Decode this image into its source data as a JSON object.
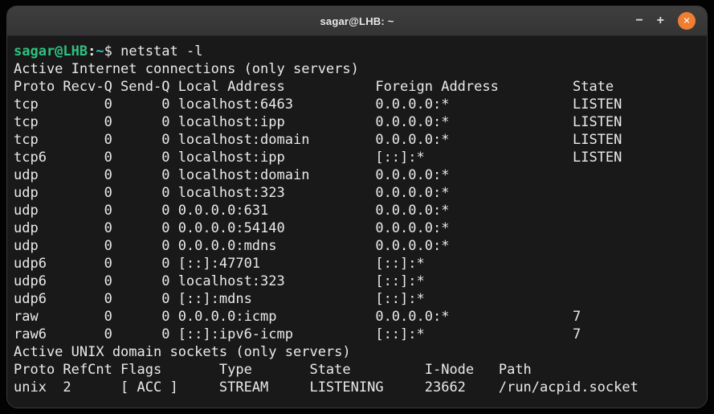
{
  "window": {
    "title": "sagar@LHB: ~",
    "controls": {
      "minimize_glyph": "−",
      "maximize_glyph": "+",
      "close_glyph": "✕"
    }
  },
  "colors": {
    "prompt_green": "#2ec27e",
    "prompt_teal": "#34c2ab",
    "close_button_orange": "#ef7d32",
    "terminal_foreground": "#eaeaea"
  },
  "terminal": {
    "prompt": {
      "user_host": "sagar@LHB",
      "separator": ":",
      "path": "~",
      "symbol": "$",
      "command": "netstat -l"
    },
    "internet_section": {
      "title": "Active Internet connections (only servers)",
      "headers": {
        "proto": "Proto",
        "recv_q": "Recv-Q",
        "send_q": "Send-Q",
        "local": "Local Address",
        "foreign": "Foreign Address",
        "state": "State"
      },
      "rows": [
        {
          "proto": "tcp",
          "recv_q": "0",
          "send_q": "0",
          "local": "localhost:6463",
          "foreign": "0.0.0.0:*",
          "state": "LISTEN"
        },
        {
          "proto": "tcp",
          "recv_q": "0",
          "send_q": "0",
          "local": "localhost:ipp",
          "foreign": "0.0.0.0:*",
          "state": "LISTEN"
        },
        {
          "proto": "tcp",
          "recv_q": "0",
          "send_q": "0",
          "local": "localhost:domain",
          "foreign": "0.0.0.0:*",
          "state": "LISTEN"
        },
        {
          "proto": "tcp6",
          "recv_q": "0",
          "send_q": "0",
          "local": "localhost:ipp",
          "foreign": "[::]:*",
          "state": "LISTEN"
        },
        {
          "proto": "udp",
          "recv_q": "0",
          "send_q": "0",
          "local": "localhost:domain",
          "foreign": "0.0.0.0:*",
          "state": ""
        },
        {
          "proto": "udp",
          "recv_q": "0",
          "send_q": "0",
          "local": "localhost:323",
          "foreign": "0.0.0.0:*",
          "state": ""
        },
        {
          "proto": "udp",
          "recv_q": "0",
          "send_q": "0",
          "local": "0.0.0.0:631",
          "foreign": "0.0.0.0:*",
          "state": ""
        },
        {
          "proto": "udp",
          "recv_q": "0",
          "send_q": "0",
          "local": "0.0.0.0:54140",
          "foreign": "0.0.0.0:*",
          "state": ""
        },
        {
          "proto": "udp",
          "recv_q": "0",
          "send_q": "0",
          "local": "0.0.0.0:mdns",
          "foreign": "0.0.0.0:*",
          "state": ""
        },
        {
          "proto": "udp6",
          "recv_q": "0",
          "send_q": "0",
          "local": "[::]:47701",
          "foreign": "[::]:*",
          "state": ""
        },
        {
          "proto": "udp6",
          "recv_q": "0",
          "send_q": "0",
          "local": "localhost:323",
          "foreign": "[::]:*",
          "state": ""
        },
        {
          "proto": "udp6",
          "recv_q": "0",
          "send_q": "0",
          "local": "[::]:mdns",
          "foreign": "[::]:*",
          "state": ""
        },
        {
          "proto": "raw",
          "recv_q": "0",
          "send_q": "0",
          "local": "0.0.0.0:icmp",
          "foreign": "0.0.0.0:*",
          "state": "7"
        },
        {
          "proto": "raw6",
          "recv_q": "0",
          "send_q": "0",
          "local": "[::]:ipv6-icmp",
          "foreign": "[::]:*",
          "state": "7"
        }
      ]
    },
    "unix_section": {
      "title": "Active UNIX domain sockets (only servers)",
      "headers": {
        "proto": "Proto",
        "refcnt": "RefCnt",
        "flags": "Flags",
        "type": "Type",
        "state": "State",
        "inode": "I-Node",
        "path": "Path"
      },
      "rows": [
        {
          "proto": "unix",
          "refcnt": "2",
          "flags": "[ ACC ]",
          "type": "STREAM",
          "state": "LISTENING",
          "inode": "23662",
          "path": "/run/acpid.socket"
        }
      ]
    }
  }
}
